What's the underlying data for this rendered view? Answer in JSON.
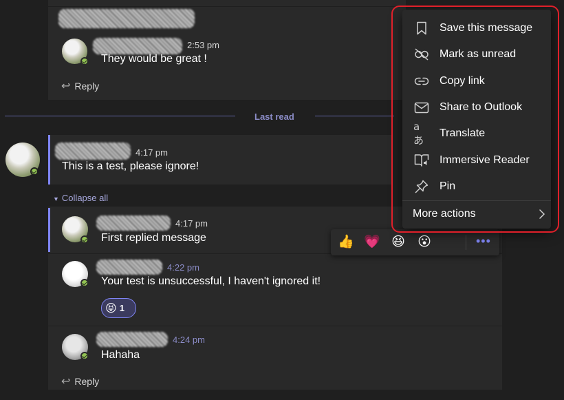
{
  "thread1": {
    "reply": {
      "time": "2:53 pm",
      "text": "They would be great !"
    },
    "reply_label": "Reply"
  },
  "last_read": "Last read",
  "thread2": {
    "root": {
      "time": "4:17 pm",
      "text": "This is a test, please ignore!"
    },
    "collapse_label": "Collapse all",
    "replies": [
      {
        "time": "4:17 pm",
        "text": "First replied message"
      },
      {
        "time": "4:22 pm",
        "text": "Your test is unsuccessful, I haven't ignored it!",
        "reaction_count": "1"
      },
      {
        "time": "4:24 pm",
        "text": "Hahaha"
      }
    ],
    "reply_label": "Reply"
  },
  "reaction_bar": {
    "emojis": [
      "thumbs-up",
      "heart",
      "laugh",
      "surprised"
    ],
    "more_icon": "more-options-icon"
  },
  "context_menu": {
    "items": [
      {
        "label": "Save this message",
        "icon": "bookmark-icon"
      },
      {
        "label": "Mark as unread",
        "icon": "mark-unread-icon"
      },
      {
        "label": "Copy link",
        "icon": "link-icon"
      },
      {
        "label": "Share to Outlook",
        "icon": "mail-icon"
      },
      {
        "label": "Translate",
        "icon": "translate-icon"
      },
      {
        "label": "Immersive Reader",
        "icon": "immersive-reader-icon"
      },
      {
        "label": "Pin",
        "icon": "pin-icon"
      }
    ],
    "more_actions": "More actions"
  },
  "colors": {
    "background": "#1f1f1f",
    "card": "#292929",
    "accent": "#7f85f5",
    "status_available": "#92c353",
    "highlight_outline": "#e0202a"
  }
}
